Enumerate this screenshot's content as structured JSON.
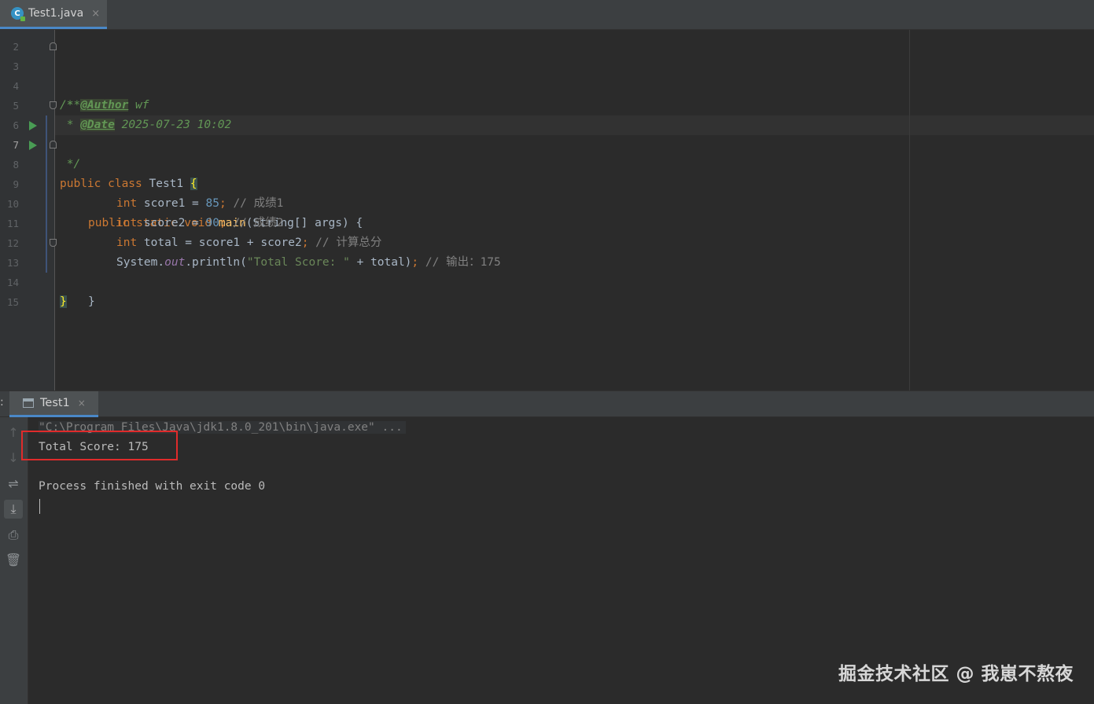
{
  "tab": {
    "file_name": "Test1.java",
    "close": "×",
    "icon": "java-class-icon"
  },
  "editor": {
    "lines": [
      {
        "num": "2"
      },
      {
        "num": "3",
        "text": "/**"
      },
      {
        "num": "4",
        "prefix": " * ",
        "tag": "@Author",
        "rest": " wf"
      },
      {
        "num": "5",
        "prefix": " * ",
        "tag": "@Date",
        "rest": " 2025-07-23 10:02"
      },
      {
        "num": "6",
        "text": " */"
      },
      {
        "num": "7",
        "kw": "public class",
        "name": " Test1 ",
        "brace": "{"
      },
      {
        "num": "8",
        "kw": "public static void",
        "fn": "main",
        "rest": "(String[] args) {"
      },
      {
        "num": "9",
        "kw": "int",
        "var": " score1 = ",
        "val": "85",
        "semi": ";",
        "comment": " // 成绩1"
      },
      {
        "num": "10",
        "kw": "int",
        "var": " score2 = ",
        "val": "90",
        "semi": ";",
        "comment": " // 成绩2"
      },
      {
        "num": "11",
        "kw": "int",
        "var": " total = score1 + score2",
        "semi": ";",
        "comment": " // 计算总分"
      },
      {
        "num": "12",
        "obj": "System.",
        "field": "out",
        "call": ".println(",
        "str": "\"Total Score: \"",
        "args": " + total)",
        "semi": ";",
        "comment": " // 输出：175"
      },
      {
        "num": "13",
        "text": "}"
      },
      {
        "num": "14",
        "brace": "}"
      },
      {
        "num": "15"
      }
    ]
  },
  "run_panel": {
    "tab_name": "Test1",
    "close": "×",
    "colon": ":",
    "command": "\"C:\\Program Files\\Java\\jdk1.8.0_201\\bin\\java.exe\" ...",
    "output": "Total Score: 175",
    "exit_message": "Process finished with exit code 0",
    "tools": [
      "up-arrow-icon",
      "down-arrow-icon",
      "soft-wrap-icon",
      "scroll-to-end-icon",
      "print-icon",
      "trash-icon"
    ]
  },
  "watermark": "掘金技术社区 @ 我崽不熬夜"
}
